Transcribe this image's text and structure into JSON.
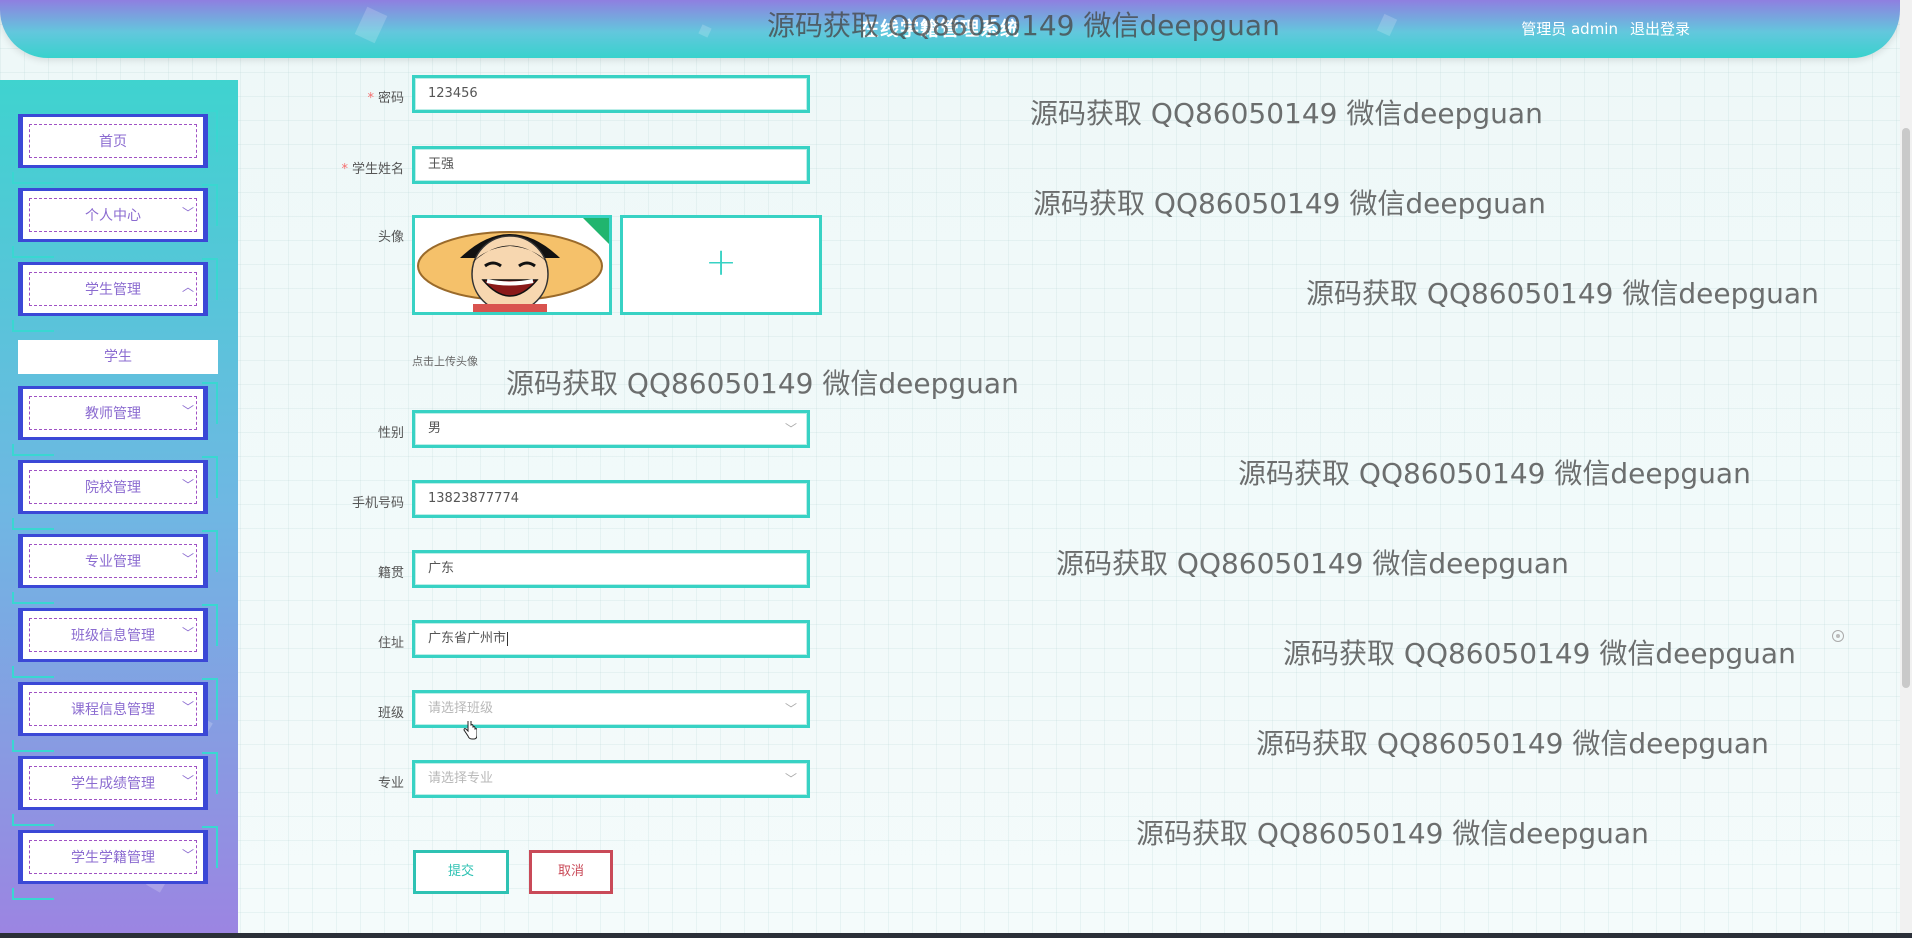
{
  "header": {
    "site_title": "在线学籍管理系统",
    "user_role": "管理员",
    "username": "admin",
    "logout_label": "退出登录"
  },
  "sidebar": {
    "items": [
      {
        "label": "首页",
        "has_arrow": false
      },
      {
        "label": "个人中心",
        "arrow": "﹀"
      },
      {
        "label": "学生管理",
        "arrow": "︿"
      },
      {
        "label": "教师管理",
        "arrow": "﹀"
      },
      {
        "label": "院校管理",
        "arrow": "﹀"
      },
      {
        "label": "专业管理",
        "arrow": "﹀"
      },
      {
        "label": "班级信息管理",
        "arrow": "﹀"
      },
      {
        "label": "课程信息管理",
        "arrow": "﹀"
      },
      {
        "label": "学生成绩管理",
        "arrow": "﹀"
      },
      {
        "label": "学生学籍管理",
        "arrow": "﹀"
      }
    ],
    "submenu_active": "学生"
  },
  "form": {
    "password": {
      "label": "密码",
      "required": true,
      "value": "123456"
    },
    "student_name": {
      "label": "学生姓名",
      "required": true,
      "value": "王强"
    },
    "avatar": {
      "label": "头像",
      "hint": "点击上传头像",
      "upload_icon": "+"
    },
    "gender": {
      "label": "性别",
      "value": "男"
    },
    "phone": {
      "label": "手机号码",
      "value": "13823877774"
    },
    "hometown": {
      "label": "籍贯",
      "value": "广东"
    },
    "address": {
      "label": "住址",
      "value": "广东省广州市"
    },
    "class": {
      "label": "班级",
      "placeholder": "请选择班级"
    },
    "major": {
      "label": "专业",
      "placeholder": "请选择专业"
    },
    "submit_label": "提交",
    "cancel_label": "取消",
    "required_mark": "*",
    "select_arrow": "﹀"
  },
  "watermark": "源码获取 QQ86050149 微信deepguan",
  "colors": {
    "accent": "#38d2c4",
    "sidebar_border": "#3b48d6",
    "cancel": "#c94a58",
    "menu_text": "#8b6bd0"
  }
}
